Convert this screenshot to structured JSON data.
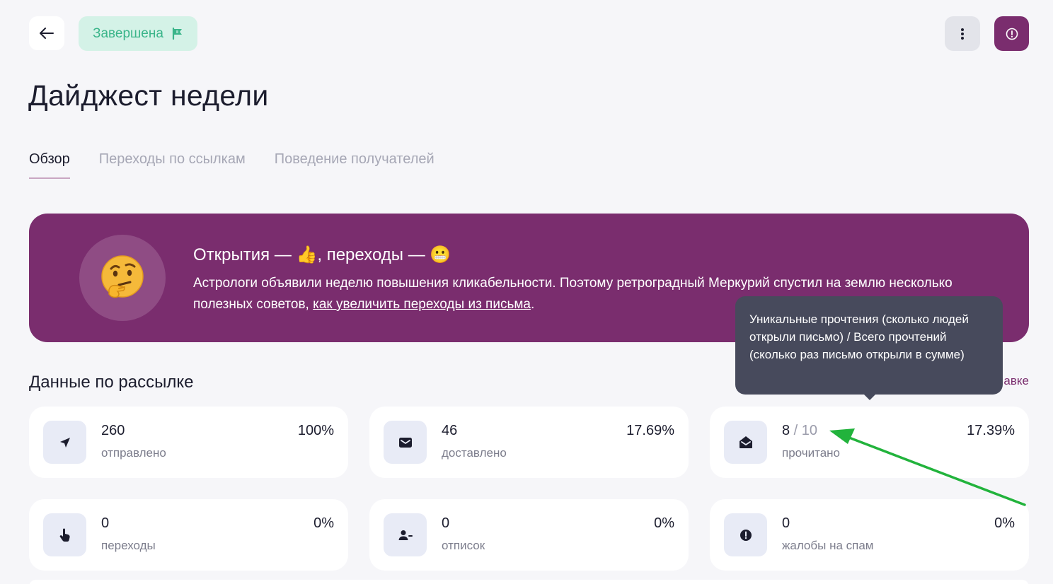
{
  "header": {
    "status_label": "Завершена"
  },
  "page_title": "Дайджест недели",
  "tabs": [
    {
      "label": "Обзор"
    },
    {
      "label": "Переходы по ссылкам"
    },
    {
      "label": "Поведение получателей"
    }
  ],
  "banner": {
    "title": "Открытия — 👍, переходы — 😬",
    "text_before": "Астрологи объявили неделю повышения кликабельности. Поэтому ретроградный Меркурий спустил на землю несколько полезных советов, ",
    "link_text": "как увеличить переходы из письма",
    "text_after": ".",
    "emoji": "🤔"
  },
  "stats_section": {
    "title": "Данные по рассылке",
    "link_partial": "авке"
  },
  "stats": [
    {
      "value": "260",
      "label": "отправлено",
      "percent": "100%",
      "icon": "send-arrow-icon"
    },
    {
      "value": "46",
      "label": "доставлено",
      "percent": "17.69%",
      "icon": "envelope-icon"
    },
    {
      "value": "8",
      "value_total": " / 10",
      "label": "прочитано",
      "percent": "17.39%",
      "icon": "open-envelope-icon"
    },
    {
      "value": "0",
      "label": "переходы",
      "percent": "0%",
      "icon": "pointer-hand-icon"
    },
    {
      "value": "0",
      "label": "отписок",
      "percent": "0%",
      "icon": "user-minus-icon"
    },
    {
      "value": "0",
      "label": "жалобы на спам",
      "percent": "0%",
      "icon": "alert-circle-icon"
    }
  ],
  "tooltip": {
    "text": "Уникальные прочтения (сколько людей открыли письмо) / Всего прочтений (сколько раз письмо открыли в сумме)"
  },
  "colors": {
    "accent": "#7a2d6e",
    "status_bg": "#d4f2e7",
    "status_text": "#3ab58a",
    "annotation_arrow": "#22b33c",
    "tooltip_bg": "#474a5c"
  }
}
